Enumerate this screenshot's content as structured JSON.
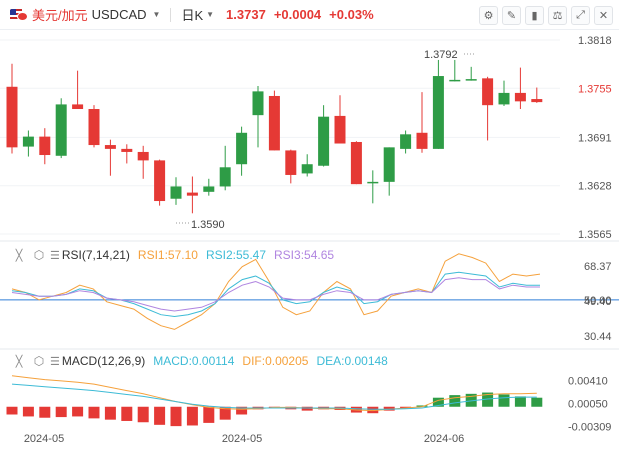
{
  "header": {
    "symbol_cn": "美元/加元",
    "symbol": "USDCAD",
    "period": "日K",
    "price": "1.3737",
    "change": "+0.0004",
    "change_pct": "+0.03%",
    "tool_icons": [
      "settings-icon",
      "draw-pen-icon",
      "candle-type-icon",
      "indicator-icon",
      "fullscreen-icon",
      "close-icon"
    ]
  },
  "colors": {
    "up": "#2e9c46",
    "down": "#e53935",
    "rsi1": "#f5a13c",
    "rsi2": "#3dbbd6",
    "rsi3": "#b085e0",
    "ref_line": "#2f7ed8"
  },
  "chart_data": [
    {
      "type": "candlestick",
      "title": "",
      "ylim": [
        1.3565,
        1.3818
      ],
      "yticks": [
        "1.3818",
        "1.3755",
        "1.3691",
        "1.3628",
        "1.3565"
      ],
      "xticks": [
        "2024-05",
        "2024-05",
        "2024-06"
      ],
      "annotations": {
        "high": "1.3792",
        "low": "1.3590"
      },
      "candles": [
        {
          "o": 1.3757,
          "h": 1.3787,
          "l": 1.367,
          "c": 1.3678
        },
        {
          "o": 1.3679,
          "h": 1.37,
          "l": 1.3666,
          "c": 1.3692
        },
        {
          "o": 1.3692,
          "h": 1.3703,
          "l": 1.3656,
          "c": 1.3668
        },
        {
          "o": 1.3667,
          "h": 1.3742,
          "l": 1.3664,
          "c": 1.3734
        },
        {
          "o": 1.3734,
          "h": 1.3778,
          "l": 1.3729,
          "c": 1.3728
        },
        {
          "o": 1.3728,
          "h": 1.3733,
          "l": 1.3678,
          "c": 1.3681
        },
        {
          "o": 1.3681,
          "h": 1.3688,
          "l": 1.3641,
          "c": 1.3676
        },
        {
          "o": 1.3676,
          "h": 1.3682,
          "l": 1.3657,
          "c": 1.3672
        },
        {
          "o": 1.3672,
          "h": 1.368,
          "l": 1.3637,
          "c": 1.3661
        },
        {
          "o": 1.3661,
          "h": 1.3662,
          "l": 1.3602,
          "c": 1.3608
        },
        {
          "o": 1.3611,
          "h": 1.3639,
          "l": 1.3603,
          "c": 1.3627
        },
        {
          "o": 1.3619,
          "h": 1.364,
          "l": 1.3592,
          "c": 1.3615
        },
        {
          "o": 1.362,
          "h": 1.3637,
          "l": 1.3615,
          "c": 1.3627
        },
        {
          "o": 1.3627,
          "h": 1.368,
          "l": 1.3622,
          "c": 1.3652
        },
        {
          "o": 1.3656,
          "h": 1.3705,
          "l": 1.3641,
          "c": 1.3697
        },
        {
          "o": 1.372,
          "h": 1.3758,
          "l": 1.3678,
          "c": 1.3751
        },
        {
          "o": 1.3745,
          "h": 1.3752,
          "l": 1.3674,
          "c": 1.3674
        },
        {
          "o": 1.3674,
          "h": 1.3675,
          "l": 1.3631,
          "c": 1.3642
        },
        {
          "o": 1.3644,
          "h": 1.3669,
          "l": 1.364,
          "c": 1.3656
        },
        {
          "o": 1.3654,
          "h": 1.3733,
          "l": 1.3653,
          "c": 1.3718
        },
        {
          "o": 1.3719,
          "h": 1.3746,
          "l": 1.3683,
          "c": 1.3683
        },
        {
          "o": 1.3685,
          "h": 1.3686,
          "l": 1.363,
          "c": 1.363
        },
        {
          "o": 1.3633,
          "h": 1.3648,
          "l": 1.3605,
          "c": 1.3633
        },
        {
          "o": 1.3633,
          "h": 1.3678,
          "l": 1.3615,
          "c": 1.3678
        },
        {
          "o": 1.3676,
          "h": 1.37,
          "l": 1.367,
          "c": 1.3695
        },
        {
          "o": 1.3697,
          "h": 1.375,
          "l": 1.3671,
          "c": 1.3676
        },
        {
          "o": 1.3676,
          "h": 1.3792,
          "l": 1.3676,
          "c": 1.3771
        },
        {
          "o": 1.3766,
          "h": 1.3792,
          "l": 1.3764,
          "c": 1.3766
        },
        {
          "o": 1.3766,
          "h": 1.3783,
          "l": 1.3765,
          "c": 1.3767
        },
        {
          "o": 1.3768,
          "h": 1.377,
          "l": 1.3687,
          "c": 1.3733
        },
        {
          "o": 1.3734,
          "h": 1.3765,
          "l": 1.3732,
          "c": 1.3749
        },
        {
          "o": 1.3749,
          "h": 1.3782,
          "l": 1.3728,
          "c": 1.3738
        },
        {
          "o": 1.3741,
          "h": 1.3756,
          "l": 1.3736,
          "c": 1.3737
        }
      ]
    },
    {
      "type": "line",
      "name": "RSI(7,14,21)",
      "labels": {
        "rsi1": "RSI1:57.10",
        "rsi2": "RSI2:55.47",
        "rsi3": "RSI3:54.65"
      },
      "ylim": [
        25,
        76
      ],
      "yticks": [
        "68.37",
        "50.00",
        "49.40",
        "30.44"
      ],
      "ref_value": 50,
      "series": [
        {
          "values": [
            56,
            54,
            50,
            52,
            54,
            58,
            56,
            49,
            47,
            45,
            40,
            36,
            34,
            38,
            42,
            48,
            60,
            68,
            72,
            60,
            46,
            42,
            44,
            54,
            60,
            56,
            42,
            44,
            52,
            54,
            56,
            54,
            71,
            75,
            73,
            70,
            60,
            64,
            63,
            64
          ]
        },
        {
          "values": [
            55,
            54,
            52,
            52,
            53,
            56,
            55,
            51,
            50,
            48,
            45,
            42,
            41,
            42,
            44,
            48,
            56,
            61,
            63,
            59,
            50,
            48,
            49,
            54,
            57,
            55,
            48,
            49,
            53,
            54,
            55,
            54,
            64,
            65,
            64,
            63,
            57,
            59,
            58,
            58
          ]
        },
        {
          "values": [
            54,
            53,
            52,
            52,
            53,
            55,
            54,
            51,
            50,
            49,
            47,
            45,
            44,
            45,
            46,
            49,
            54,
            58,
            60,
            57,
            51,
            50,
            50,
            53,
            55,
            54,
            50,
            50,
            53,
            54,
            55,
            54,
            61,
            62,
            61,
            61,
            56,
            58,
            57,
            57
          ]
        }
      ]
    },
    {
      "type": "bar",
      "name": "MACD(12,26,9)",
      "labels": {
        "macd": "MACD:0.00114",
        "dif": "DIF:0.00205",
        "dea": "DEA:0.00148"
      },
      "ylim": [
        -0.0036,
        0.006
      ],
      "yticks": [
        "0.00410",
        "0.00050",
        "-0.00309"
      ],
      "histogram": [
        -0.0012,
        -0.0015,
        -0.0017,
        -0.0016,
        -0.0015,
        -0.0018,
        -0.002,
        -0.0022,
        -0.0024,
        -0.0028,
        -0.003,
        -0.0029,
        -0.0025,
        -0.002,
        -0.0012,
        -0.0004,
        -0.0002,
        -0.0004,
        -0.0006,
        -0.0004,
        -0.0005,
        -0.0009,
        -0.001,
        -0.0006,
        -0.0002,
        0.0002,
        0.0014,
        0.0018,
        0.002,
        0.0022,
        0.0019,
        0.0016,
        0.0014
      ],
      "dif": [
        0.0048,
        0.0045,
        0.0042,
        0.004,
        0.0038,
        0.0035,
        0.003,
        0.0025,
        0.002,
        0.0014,
        0.0008,
        0.0003,
        -0.0001,
        -0.0003,
        -0.0004,
        -0.0003,
        -0.0001,
        -0.0001,
        -0.0002,
        -0.0003,
        -0.0003,
        -0.0005,
        -0.0006,
        -0.0004,
        -0.0002,
        0.0,
        0.001,
        0.0014,
        0.0016,
        0.0019,
        0.002,
        0.002,
        0.0021
      ],
      "dea": [
        0.0035,
        0.0033,
        0.0031,
        0.0029,
        0.0027,
        0.0025,
        0.0022,
        0.0019,
        0.0016,
        0.0012,
        0.0008,
        0.0004,
        0.0001,
        -0.0001,
        -0.0002,
        -0.0002,
        -0.0002,
        -0.0002,
        -0.0002,
        -0.0002,
        -0.0002,
        -0.0003,
        -0.0004,
        -0.0004,
        -0.0003,
        -0.0002,
        0.0002,
        0.0006,
        0.0009,
        0.0012,
        0.0014,
        0.0015,
        0.0015
      ]
    }
  ]
}
